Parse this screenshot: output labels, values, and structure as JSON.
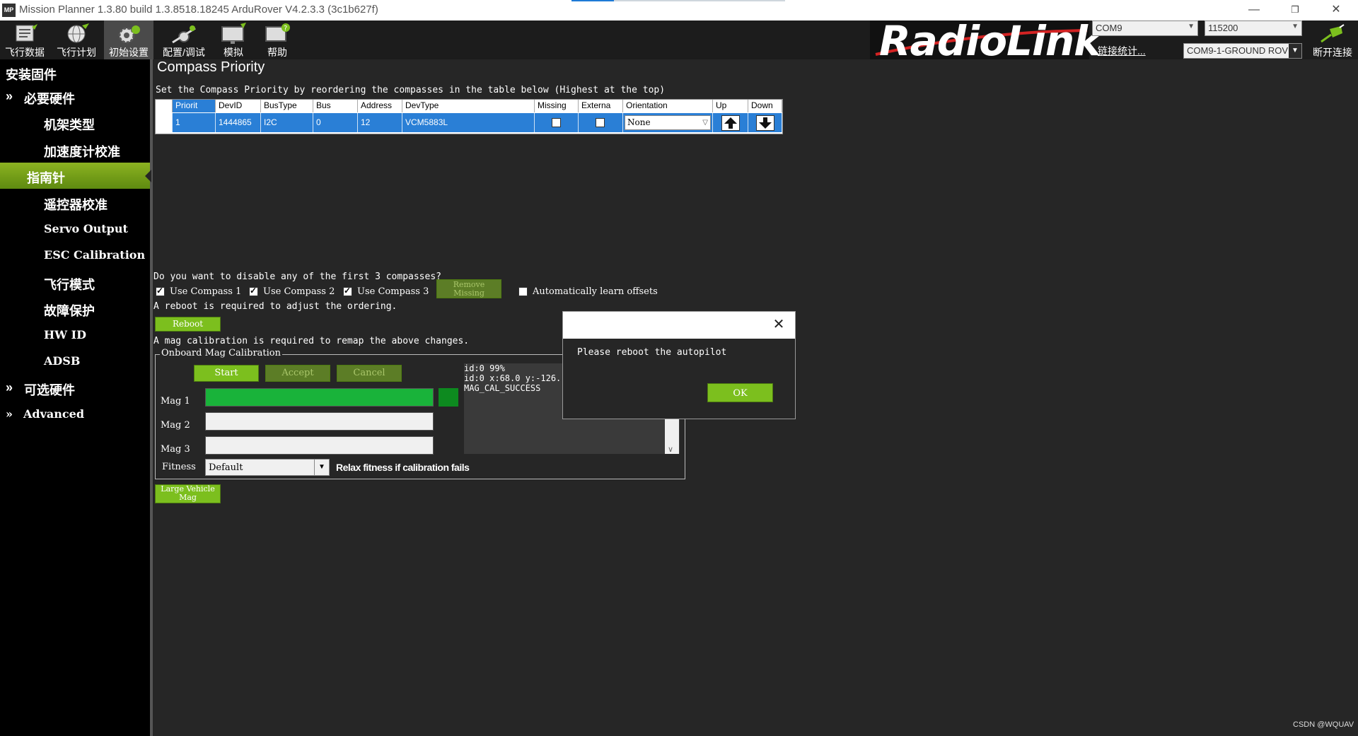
{
  "window": {
    "title": "Mission Planner 1.3.80 build 1.3.8518.18245 ArduRover V4.2.3.3 (3c1b627f)",
    "minimize": "—",
    "restore": "❐",
    "close": "✕"
  },
  "toolbar": {
    "buttons": [
      {
        "label": "飞行数据",
        "icon": "flight-data-icon"
      },
      {
        "label": "飞行计划",
        "icon": "flight-plan-icon"
      },
      {
        "label": "初始设置",
        "icon": "initial-setup-icon"
      },
      {
        "label": "配置/调试",
        "icon": "config-tuning-icon"
      },
      {
        "label": "模拟",
        "icon": "simulation-icon"
      },
      {
        "label": "帮助",
        "icon": "help-icon"
      }
    ],
    "logo": "RadioLink",
    "port": "COM9",
    "baud": "115200",
    "link_stats": "链接统计...",
    "connection": "COM9-1-GROUND ROV",
    "disconnect": "断开连接"
  },
  "sidebar": {
    "header": "安装固件",
    "items": [
      {
        "label": "必要硬件",
        "prefix": "»"
      },
      {
        "label": "机架类型"
      },
      {
        "label": "加速度计校准"
      },
      {
        "label": "指南针"
      },
      {
        "label": "遥控器校准"
      },
      {
        "label": "Servo Output"
      },
      {
        "label": "ESC Calibration"
      },
      {
        "label": "飞行模式"
      },
      {
        "label": "故障保护"
      },
      {
        "label": "HW ID"
      },
      {
        "label": "ADSB"
      },
      {
        "label": "可选硬件",
        "prefix": "»"
      },
      {
        "label": "Advanced",
        "prefix": "»"
      }
    ]
  },
  "page": {
    "title": "Compass Priority",
    "instructions": "Set the Compass Priority by reordering the compasses in the table below (Highest at the top)",
    "table": {
      "headers": [
        "Priorit",
        "DevID",
        "BusType",
        "Bus",
        "Address",
        "DevType",
        "Missing",
        "Externa",
        "Orientation",
        "Up",
        "Down"
      ],
      "rows": [
        {
          "priority": "1",
          "devid": "1444865",
          "bustype": "I2C",
          "bus": "0",
          "address": "12",
          "devtype": "VCM5883L",
          "orientation": "None"
        }
      ]
    },
    "disable_question": "Do you want to disable any of the first 3 compasses?",
    "use_compass_1": "Use Compass 1",
    "use_compass_2": "Use Compass 2",
    "use_compass_3": "Use Compass 3",
    "remove_missing": "Remove Missing",
    "auto_learn": "Automatically learn offsets",
    "reboot_note": "A reboot is required to adjust the ordering.",
    "reboot_button": "Reboot",
    "mag_cal_note": "A mag calibration is required to remap the above changes.",
    "onboard_title": "Onboard Mag Calibration",
    "start": "Start",
    "accept": "Accept",
    "cancel": "Cancel",
    "mag1": "Mag 1",
    "mag2": "Mag 2",
    "mag3": "Mag 3",
    "mag1_progress": 1.0,
    "mag2_progress": 0,
    "mag3_progress": 0,
    "fitness_label": "Fitness",
    "fitness_value": "Default",
    "relax_fitness": "Relax fitness if calibration fails",
    "log_lines": [
      "id:0 99%",
      "id:0 x:68.0 y:-126.",
      "MAG_CAL_SUCCESS"
    ],
    "large_vehicle_mag": "Large Vehicle Mag"
  },
  "dialog": {
    "message": "Please reboot the autopilot",
    "ok": "OK"
  },
  "watermark": "CSDN @WQUAV",
  "colors": {
    "accent_green": "#7cbf1e",
    "progress_green": "#19b33a",
    "selection_blue": "#2a7fd6",
    "background": "#262626"
  }
}
